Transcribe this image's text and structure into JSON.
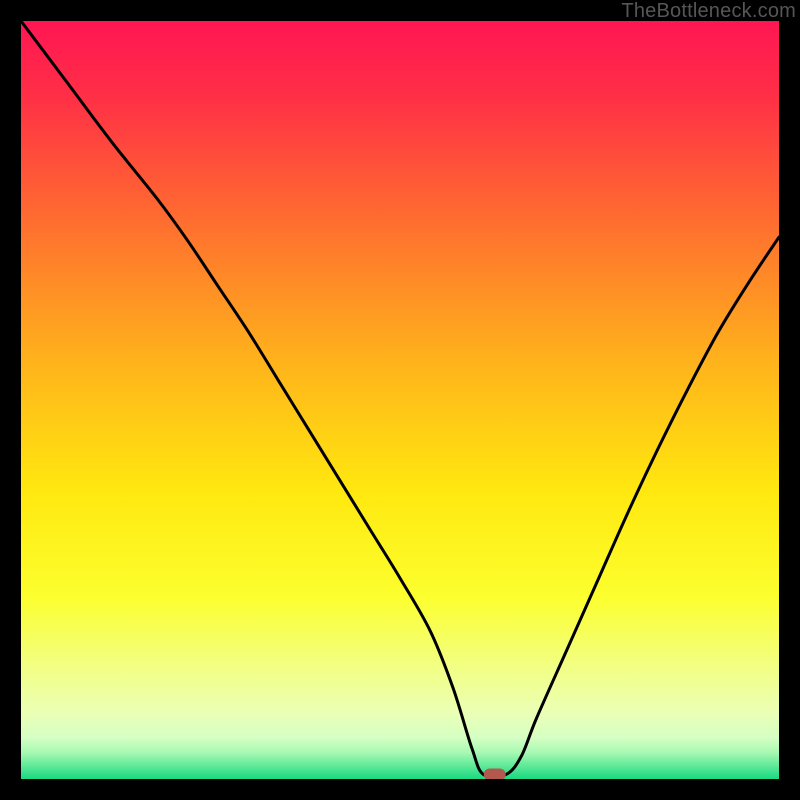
{
  "watermark": "TheBottleneck.com",
  "chart_data": {
    "type": "line",
    "title": "",
    "xlabel": "",
    "ylabel": "",
    "xlim": [
      0,
      100
    ],
    "ylim": [
      0,
      100
    ],
    "grid": false,
    "series": [
      {
        "name": "bottleneck-curve",
        "x": [
          0,
          6,
          12,
          18,
          22,
          26,
          30,
          34,
          38,
          42,
          46,
          50,
          54,
          57,
          59.5,
          61,
          64,
          66,
          68,
          72,
          76,
          80,
          84,
          88,
          92,
          96,
          100
        ],
        "y": [
          100,
          92,
          84,
          76.5,
          71,
          65,
          59,
          52.5,
          46,
          39.5,
          33,
          26.5,
          19.5,
          12,
          4,
          0.6,
          0.6,
          3,
          8,
          17,
          26,
          35,
          43.5,
          51.5,
          59,
          65.5,
          71.5
        ]
      }
    ],
    "marker": {
      "name": "optimal-point",
      "x": 62.5,
      "y": 0.6,
      "color": "#b3584f"
    },
    "gradient_stops": [
      {
        "offset": 0.0,
        "color": "#ff1653"
      },
      {
        "offset": 0.1,
        "color": "#ff2f46"
      },
      {
        "offset": 0.25,
        "color": "#ff6831"
      },
      {
        "offset": 0.45,
        "color": "#ffb31b"
      },
      {
        "offset": 0.62,
        "color": "#ffe80f"
      },
      {
        "offset": 0.76,
        "color": "#fcff2e"
      },
      {
        "offset": 0.85,
        "color": "#f2ff82"
      },
      {
        "offset": 0.912,
        "color": "#ebffb4"
      },
      {
        "offset": 0.945,
        "color": "#d6ffc4"
      },
      {
        "offset": 0.965,
        "color": "#a8f9b3"
      },
      {
        "offset": 0.982,
        "color": "#61ea99"
      },
      {
        "offset": 1.0,
        "color": "#19d981"
      }
    ]
  }
}
